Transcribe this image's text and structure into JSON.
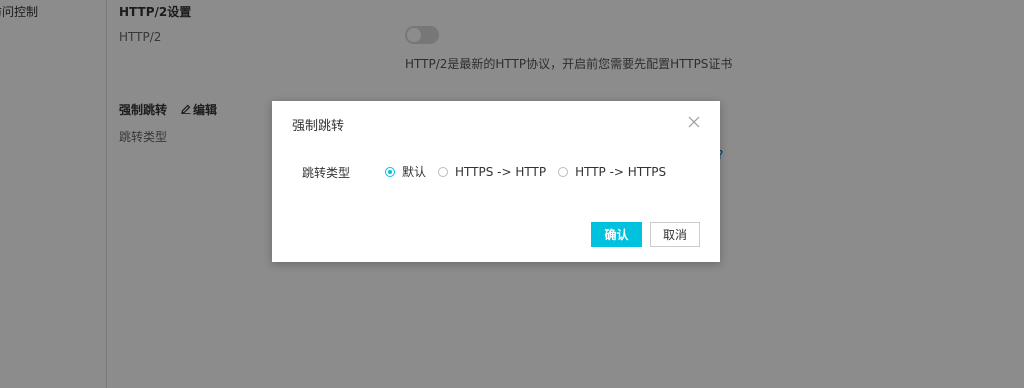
{
  "sidebar": {
    "items": [
      {
        "label": "访问控制"
      }
    ]
  },
  "http2": {
    "title": "HTTP/2设置",
    "label": "HTTP/2",
    "enabled": false,
    "description": "HTTP/2是最新的HTTP协议，开启前您需要先配置HTTPS证书"
  },
  "force_redirect": {
    "title": "强制跳转",
    "edit_label": "编辑",
    "type_label": "跳转类型",
    "help_mark": "?"
  },
  "modal": {
    "title": "强制跳转",
    "field_label": "跳转类型",
    "options": [
      {
        "label": "默认",
        "checked": true
      },
      {
        "label": "HTTPS -> HTTP",
        "checked": false
      },
      {
        "label": "HTTP -> HTTPS",
        "checked": false
      }
    ],
    "confirm_label": "确认",
    "cancel_label": "取消"
  },
  "colors": {
    "accent": "#00c1de",
    "overlay": "rgba(0,0,0,0.45)"
  },
  "icons": {
    "close": "close-icon",
    "edit": "pencil-icon"
  }
}
